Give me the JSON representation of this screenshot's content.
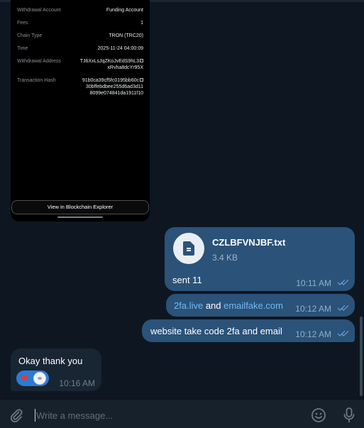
{
  "screenshot": {
    "rows": [
      {
        "key": "Withdrawal Account",
        "value": "Funding Account"
      },
      {
        "key": "Fees",
        "value": "1"
      },
      {
        "key": "Chain Type",
        "value": "TRON (TRC20)"
      },
      {
        "key": "Time",
        "value": "2025-11-24 04:00:09"
      },
      {
        "key": "Withdrawal Address",
        "value_line1": "TJ6XxLsJqZKoJvEdS9hL3",
        "value_line2": "xRvha8dcYr95X"
      },
      {
        "key": "Transaction Hash",
        "value_line1": "91b0ca39cf5fc0195bb60c",
        "value_line2": "30bffebdbee255d6ad3d11",
        "value_line3": "8099e074841da1911f10"
      }
    ],
    "explorer_button": "View in Blockchain Explorer"
  },
  "messages": {
    "file": {
      "name": "CZLBFVNJBF.txt",
      "size": "3.4 KB",
      "caption": "sent 11",
      "time": "10:11 AM",
      "icon": "file-icon"
    },
    "links": {
      "link1": "2fa.live",
      "connector": " and ",
      "link2": "emailfake.com",
      "time": "10:12 AM"
    },
    "website": {
      "text": "website take code 2fa and email",
      "time": "10:12 AM"
    },
    "incoming": {
      "text": "Okay thank you",
      "time": "10:16 AM",
      "reaction": "❤"
    }
  },
  "composer": {
    "placeholder": "Write a message...",
    "icons": [
      "paperclip-icon",
      "emoji-icon",
      "microphone-icon"
    ]
  },
  "colors": {
    "background": "#0e1621",
    "outgoing_bubble": "#2b5278",
    "incoming_bubble": "#182533",
    "link": "#71baf5",
    "composer": "#17212b"
  }
}
